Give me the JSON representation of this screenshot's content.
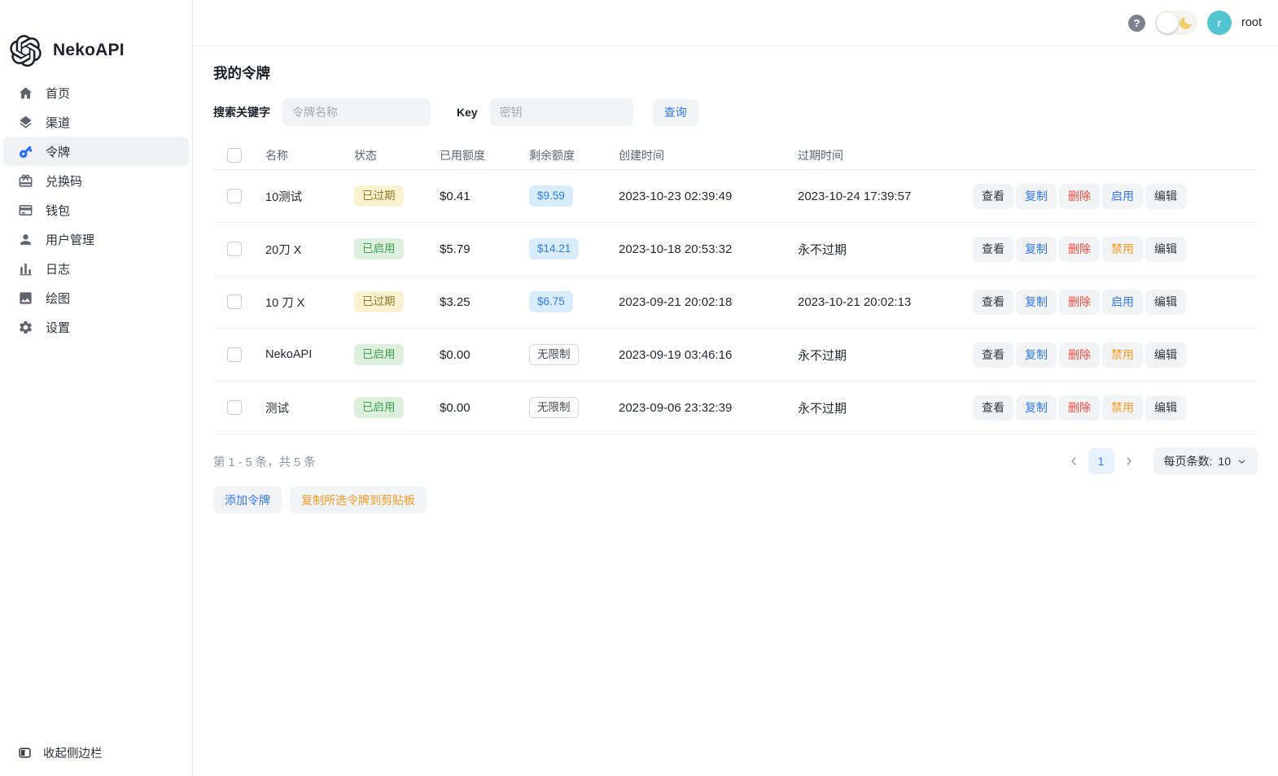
{
  "app": {
    "title": "NekoAPI"
  },
  "sidebar": {
    "items": [
      {
        "label": "首页",
        "icon": "home-icon"
      },
      {
        "label": "渠道",
        "icon": "layers-icon"
      },
      {
        "label": "令牌",
        "icon": "key-icon",
        "active": true
      },
      {
        "label": "兑换码",
        "icon": "gift-icon"
      },
      {
        "label": "钱包",
        "icon": "wallet-icon"
      },
      {
        "label": "用户管理",
        "icon": "user-icon"
      },
      {
        "label": "日志",
        "icon": "bar-chart-icon"
      },
      {
        "label": "绘图",
        "icon": "image-icon"
      },
      {
        "label": "设置",
        "icon": "gear-icon"
      }
    ],
    "collapse_label": "收起侧边栏"
  },
  "header": {
    "avatar_letter": "r",
    "username": "root"
  },
  "page": {
    "title": "我的令牌"
  },
  "search": {
    "keyword_label": "搜索关键字",
    "keyword_placeholder": "令牌名称",
    "key_label": "Key",
    "key_placeholder": "密钥",
    "query_label": "查询"
  },
  "table": {
    "columns": [
      "名称",
      "状态",
      "已用额度",
      "剩余额度",
      "创建时间",
      "过期时间"
    ],
    "actions": {
      "view": "查看",
      "copy": "复制",
      "delete": "删除",
      "edit": "编辑"
    },
    "rows": [
      {
        "name": "10测试",
        "status": "已过期",
        "status_type": "expired",
        "used": "$0.41",
        "remain": "$9.59",
        "remain_type": "amount",
        "created": "2023-10-23 02:39:49",
        "expires": "2023-10-24 17:39:57",
        "toggle": "启用",
        "toggle_type": "enable"
      },
      {
        "name": "20刀 X",
        "status": "已启用",
        "status_type": "enabled",
        "used": "$5.79",
        "remain": "$14.21",
        "remain_type": "amount",
        "created": "2023-10-18 20:53:32",
        "expires": "永不过期",
        "toggle": "禁用",
        "toggle_type": "disable"
      },
      {
        "name": "10 刀 X",
        "status": "已过期",
        "status_type": "expired",
        "used": "$3.25",
        "remain": "$6.75",
        "remain_type": "amount",
        "created": "2023-09-21 20:02:18",
        "expires": "2023-10-21 20:02:13",
        "toggle": "启用",
        "toggle_type": "enable"
      },
      {
        "name": "NekoAPI",
        "status": "已启用",
        "status_type": "enabled",
        "used": "$0.00",
        "remain": "无限制",
        "remain_type": "unlimited",
        "created": "2023-09-19 03:46:16",
        "expires": "永不过期",
        "toggle": "禁用",
        "toggle_type": "disable"
      },
      {
        "name": "测试",
        "status": "已启用",
        "status_type": "enabled",
        "used": "$0.00",
        "remain": "无限制",
        "remain_type": "unlimited",
        "created": "2023-09-06 23:32:39",
        "expires": "永不过期",
        "toggle": "禁用",
        "toggle_type": "disable"
      }
    ]
  },
  "pagination": {
    "summary": "第 1 - 5 条，共 5 条",
    "current_page": "1",
    "page_size_label": "每页条数:",
    "page_size": "10"
  },
  "footer_buttons": {
    "add": "添加令牌",
    "copy_selected": "复制所选令牌到剪贴板"
  },
  "colors": {
    "accent_blue": "#3377f6",
    "danger_red": "#f5483d",
    "warning_orange": "#f59a23",
    "badge_expired_bg": "#f9f3d2",
    "badge_expired_text": "#95782a",
    "badge_enabled_bg": "#ddefdf",
    "badge_enabled_text": "#3da14a",
    "badge_amount_bg": "#d9ecfb",
    "badge_amount_text": "#2f7de1",
    "avatar_teal": "#52c5d0",
    "active_key_icon_blue": "#2b6df4"
  }
}
